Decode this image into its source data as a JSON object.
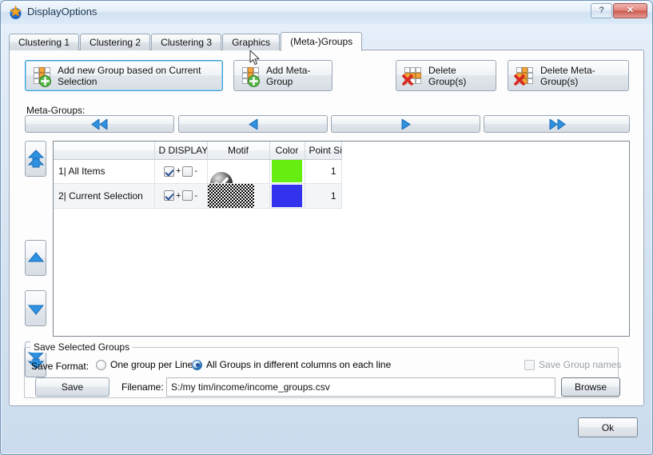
{
  "window": {
    "title": "DisplayOptions",
    "icon": "star-sphere-icon",
    "help_label": "?",
    "close_label": "✕"
  },
  "tabs": [
    {
      "label": "Clustering 1",
      "active": false
    },
    {
      "label": "Clustering 2",
      "active": false
    },
    {
      "label": "Clustering 3",
      "active": false
    },
    {
      "label": "Graphics",
      "active": false
    },
    {
      "label": "(Meta-)Groups",
      "active": true
    }
  ],
  "actions": {
    "add_group": "Add new Group based on Current Selection",
    "add_meta_group": "Add Meta-Group",
    "delete_groups": "Delete Group(s)",
    "delete_meta_groups": "Delete Meta-Group(s)"
  },
  "meta_groups": {
    "label": "Meta-Groups:",
    "nav": [
      {
        "name": "first",
        "glyph": "◀◀"
      },
      {
        "name": "previous",
        "glyph": "◀"
      },
      {
        "name": "next",
        "glyph": "▶"
      },
      {
        "name": "last",
        "glyph": "▶▶"
      }
    ]
  },
  "reorder_buttons": [
    {
      "name": "move-to-top",
      "glyph": "double-up"
    },
    {
      "name": "move-up",
      "glyph": "up"
    },
    {
      "name": "move-down",
      "glyph": "down"
    },
    {
      "name": "move-to-bottom",
      "glyph": "double-down"
    }
  ],
  "table": {
    "columns": [
      {
        "key": "name",
        "label": ""
      },
      {
        "key": "display",
        "label": "D DISPLAY"
      },
      {
        "key": "motif",
        "label": "Motif"
      },
      {
        "key": "color",
        "label": "Color"
      },
      {
        "key": "point_size",
        "label": "Point Size"
      }
    ],
    "rows": [
      {
        "name": "1| All Items",
        "display_plus": true,
        "display_minus": false,
        "plus_label": "+",
        "minus_label": "-",
        "motif": "check-sphere",
        "color": "#66EE11",
        "point_size": "1"
      },
      {
        "name": "2| Current Selection",
        "display_plus": true,
        "display_minus": false,
        "plus_label": "+",
        "minus_label": "-",
        "motif": "checkerboard",
        "color": "#3333EE",
        "point_size": "1"
      }
    ]
  },
  "save_panel": {
    "title": "Save Selected Groups",
    "format_label": "Save Format:",
    "option_one_per_line": "One group per Line",
    "option_all_columns": "All Groups in different columns on each line",
    "selected_option": "all_columns",
    "save_group_names_label": "Save Group names",
    "save_group_names_checked": false,
    "save_group_names_disabled": true,
    "save_button": "Save",
    "filename_label": "Filename:",
    "filename_value": "S:/my tim/income/income_groups.csv",
    "browse_button": "Browse"
  },
  "footer": {
    "ok_button": "Ok"
  }
}
